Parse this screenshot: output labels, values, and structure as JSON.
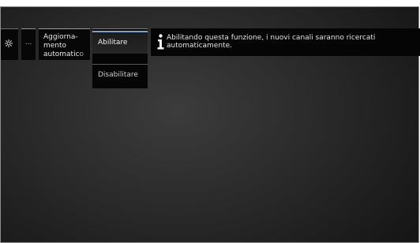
{
  "menu": {
    "settings_icon": "gear-icon",
    "more_label": "...",
    "update_label": "Aggiorna­mento automatico",
    "options": [
      {
        "label": "Abilitare",
        "selected": true
      },
      {
        "label": "Disabilitare",
        "selected": false
      }
    ]
  },
  "info": {
    "icon": "info-icon",
    "text": "Abilitando questa funzione, i nuovi canali saranno ricercati automaticamente."
  },
  "colors": {
    "accent": "#7fa3c7",
    "panel_bg": "#050505",
    "text": "#e8e8e8"
  }
}
